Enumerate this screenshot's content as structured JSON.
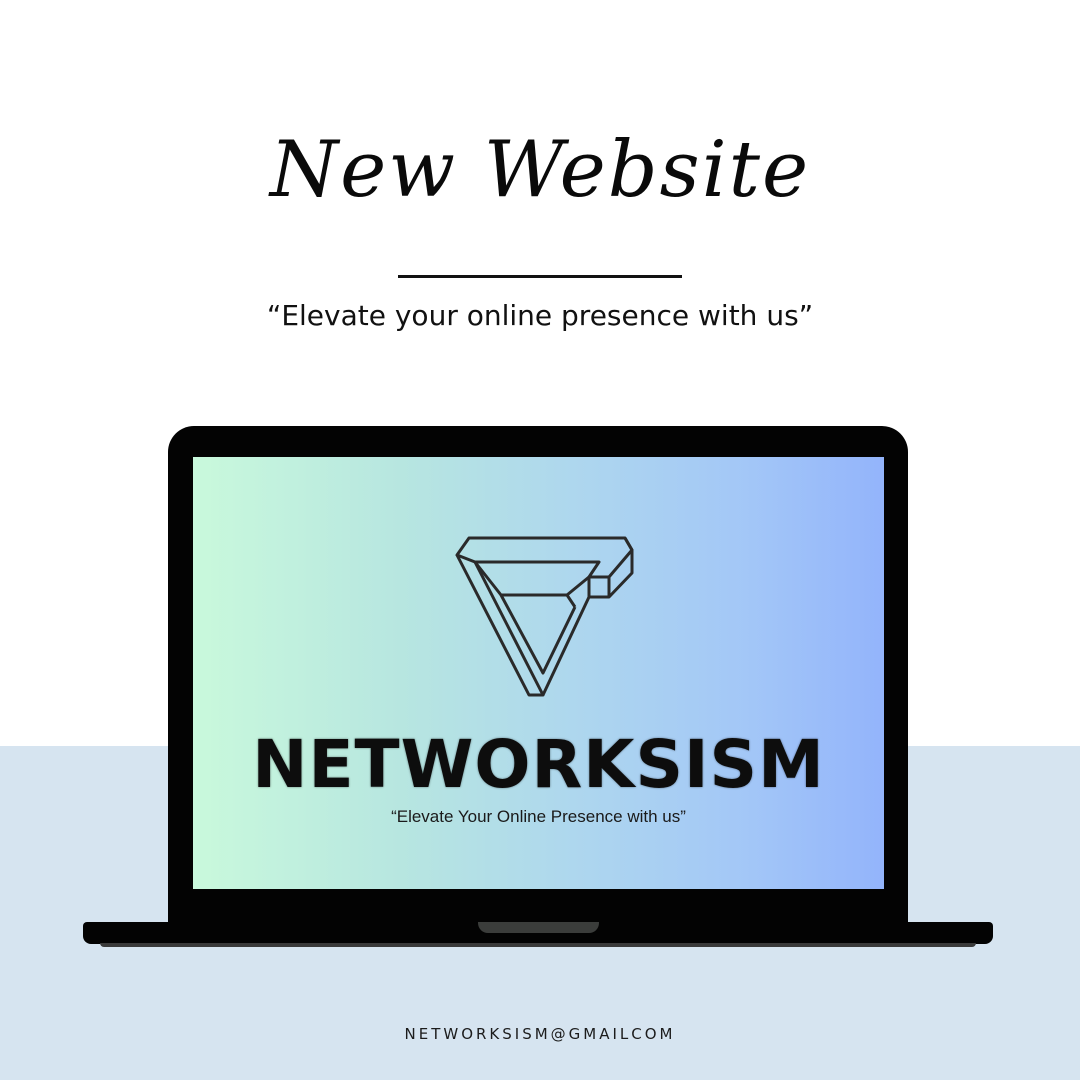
{
  "header": {
    "headline": "New Website",
    "tagline": "“Elevate your online presence with us”"
  },
  "laptop": {
    "screen": {
      "logo_icon": "impossible-triangle-logo",
      "brand_name": "NETWORKSISM",
      "brand_tagline": "“Elevate Your Online Presence with us”",
      "gradient_colors": [
        "#c9f9dc",
        "#aed7ee",
        "#93b4fb"
      ]
    }
  },
  "footer": {
    "email": "NETWORKSISM@GMAILCOM"
  },
  "colors": {
    "background": "#ffffff",
    "bottom_band": "#d6e4f0",
    "laptop_body": "#030303",
    "text": "#111111"
  }
}
